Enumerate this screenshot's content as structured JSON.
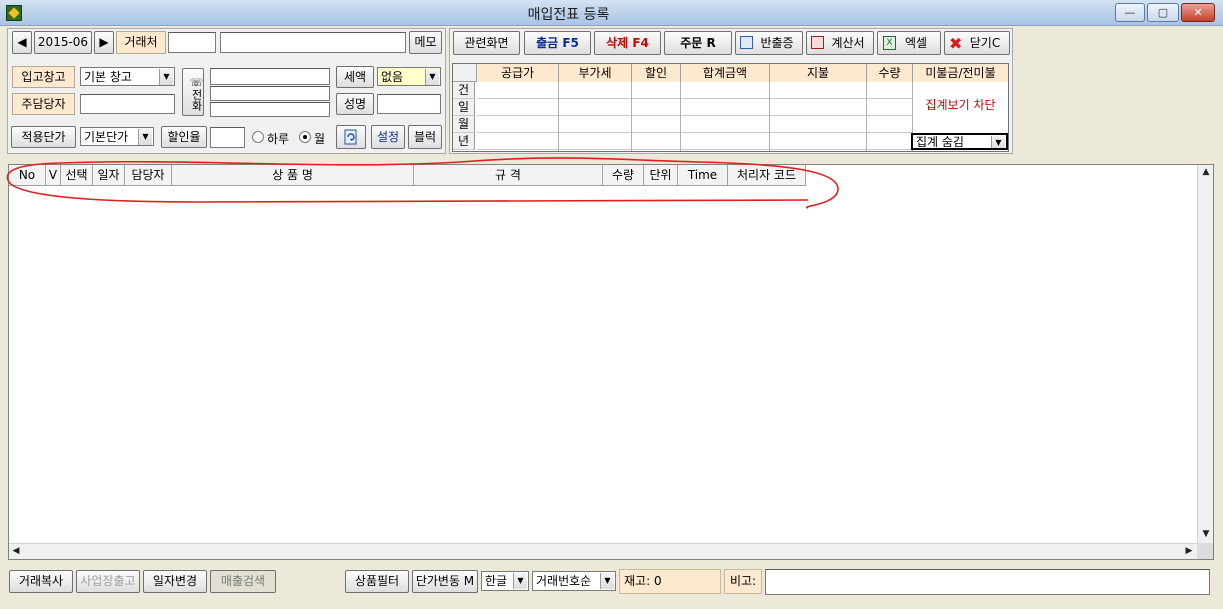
{
  "window": {
    "title": "매입전표 등록",
    "controls": {
      "minimize": "—",
      "maximize": "▢",
      "close": "✕"
    }
  },
  "top": {
    "prev_label": "◀",
    "date_value": "2015-06",
    "next_label": "▶",
    "vendor_label": "거래처",
    "vendor_code": "",
    "vendor_name": "",
    "memo_label": "메모",
    "warehouse_label": "입고창고",
    "warehouse_value": "기본 창고",
    "manager_label": "주담당자",
    "manager_value": "",
    "phone_label": "☏전화",
    "phone1": "",
    "phone2": "",
    "phone3": "",
    "tax_label": "세액",
    "tax_value": "없음",
    "name_label": "성명",
    "name_value": "",
    "price_label": "적용단가",
    "price_value": "기본단가",
    "discount_label": "할인율",
    "discount_value": "",
    "radio_day": "하루",
    "radio_month": "월",
    "settings_label": "설정",
    "block_label": "블럭"
  },
  "toolbar": {
    "related": "관련화면",
    "out": "출금 F5",
    "delete": "삭제 F4",
    "order": "주문 R",
    "return": "반출증",
    "invoice": "계산서",
    "excel": "엑셀",
    "close": "닫기C"
  },
  "summary": {
    "headers": [
      "공급가",
      "부가세",
      "할인",
      "합계금액",
      "지불",
      "수량",
      "미불금/전미불"
    ],
    "rows": [
      "건",
      "일",
      "월",
      "년"
    ],
    "block_msg": "집계보기 차단",
    "hide_combo": "집계 숨김"
  },
  "grid": {
    "columns": [
      "No",
      "V",
      "선택",
      "일자",
      "담당자",
      "상 품 명",
      "규 격",
      "수량",
      "단위",
      "Time",
      "처리자 코드"
    ]
  },
  "bottom": {
    "copy": "거래복사",
    "biz_out": "사업장출고",
    "date_change": "일자변경",
    "sales_search": "매출검색",
    "product_filter": "상품필터",
    "price_change": "단가변동 M",
    "lang": "한글",
    "sort": "거래번호순",
    "stock_label": "재고: 0",
    "note_label": "비고:",
    "note_value": ""
  },
  "colors": {
    "label_bg": "#fde9cf",
    "red_text": "#cc0000",
    "blue_text": "#0a2a9a",
    "annotation": "#e02020"
  }
}
